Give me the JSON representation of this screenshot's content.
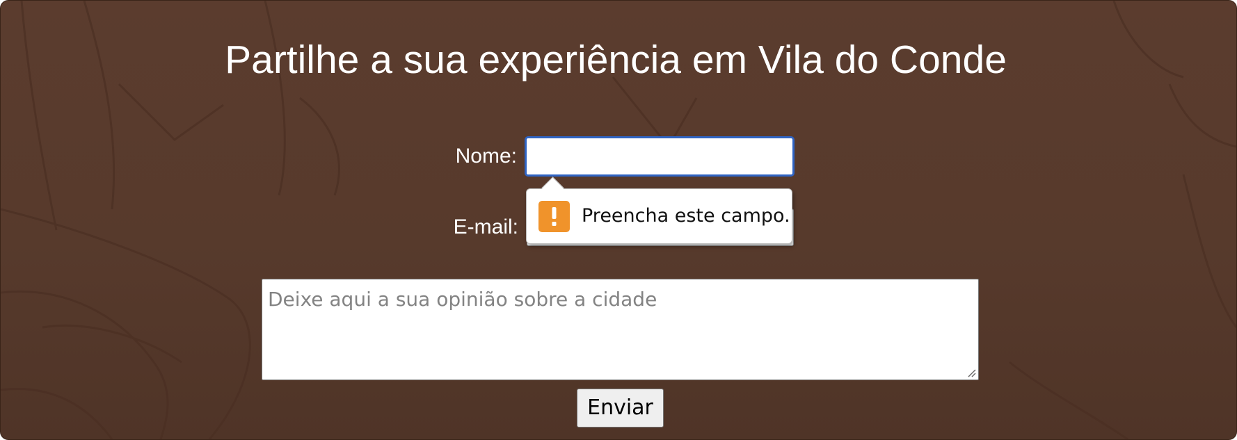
{
  "form": {
    "title": "Partilhe a sua experiência em Vila do Conde",
    "name_label": "Nome:",
    "name_value": "",
    "email_label": "E-mail:",
    "email_value": "",
    "opinion_placeholder": "Deixe aqui a sua opinião sobre a cidade",
    "submit_label": "Enviar"
  },
  "validation": {
    "message": "Preencha este campo.",
    "icon": "warning-icon"
  },
  "colors": {
    "background": "#573a2c",
    "focus_border": "#2f64c4",
    "warning": "#f0932b"
  }
}
